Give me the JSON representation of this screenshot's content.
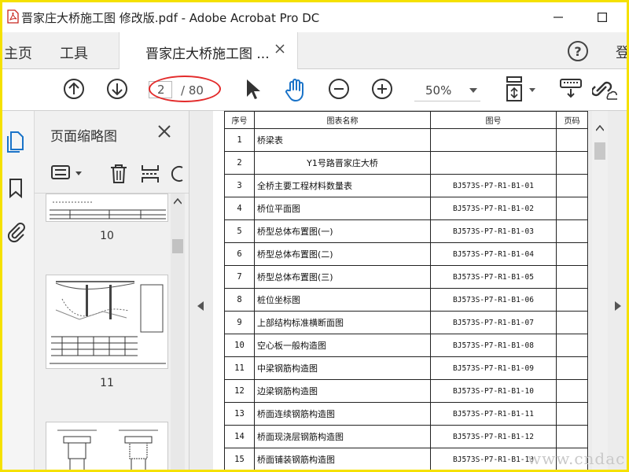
{
  "window": {
    "title": "晋家庄大桥施工图 修改版.pdf - Adobe Acrobat Pro DC"
  },
  "tabs": {
    "home": "主页",
    "tools": "工具",
    "document": "晋家庄大桥施工图 ...",
    "login": "登"
  },
  "toolbar": {
    "current_page": "2",
    "total_pages": "/ 80",
    "zoom": "50%",
    "icons": [
      "arrow-up-icon",
      "arrow-down-icon",
      "select-arrow-icon",
      "hand-icon",
      "zoom-out-icon",
      "zoom-in-icon",
      "fit-page-icon",
      "keyboard-icon",
      "share-link-icon"
    ]
  },
  "thumbnails_panel": {
    "title": "页面缩略图",
    "pages": [
      "10",
      "11"
    ]
  },
  "document": {
    "headers": [
      "序号",
      "图表名称",
      "图号",
      "页码"
    ],
    "rows": [
      {
        "no": "1",
        "name": "桥梁表",
        "code": ""
      },
      {
        "no": "2",
        "name": "Y1号路晋家庄大桥",
        "code": ""
      },
      {
        "no": "3",
        "name": "全桥主要工程材料数量表",
        "code": "BJ573S-P7-R1-B1-01"
      },
      {
        "no": "4",
        "name": "桥位平面图",
        "code": "BJ573S-P7-R1-B1-02"
      },
      {
        "no": "5",
        "name": "桥型总体布置图(一)",
        "code": "BJ573S-P7-R1-B1-03"
      },
      {
        "no": "6",
        "name": "桥型总体布置图(二)",
        "code": "BJ573S-P7-R1-B1-04"
      },
      {
        "no": "7",
        "name": "桥型总体布置图(三)",
        "code": "BJ573S-P7-R1-B1-05"
      },
      {
        "no": "8",
        "name": "桩位坐标图",
        "code": "BJ573S-P7-R1-B1-06"
      },
      {
        "no": "9",
        "name": "上部结构标准横断面图",
        "code": "BJ573S-P7-R1-B1-07"
      },
      {
        "no": "10",
        "name": "空心板一般构造图",
        "code": "BJ573S-P7-R1-B1-08"
      },
      {
        "no": "11",
        "name": "中梁钢筋构造图",
        "code": "BJ573S-P7-R1-B1-09"
      },
      {
        "no": "12",
        "name": "边梁钢筋构造图",
        "code": "BJ573S-P7-R1-B1-10"
      },
      {
        "no": "13",
        "name": "桥面连续钢筋构造图",
        "code": "BJ573S-P7-R1-B1-11"
      },
      {
        "no": "14",
        "name": "桥面现浇层钢筋构造图",
        "code": "BJ573S-P7-R1-B1-12"
      },
      {
        "no": "15",
        "name": "桥面铺装钢筋构造图",
        "code": "BJ573S-P7-R1-B1-13"
      }
    ]
  },
  "watermark": "www.cndac.com",
  "colors": {
    "frame_border": "#f5e100",
    "annotation_ellipse": "#e32b2b",
    "accent_blue": "#1a73c8"
  }
}
